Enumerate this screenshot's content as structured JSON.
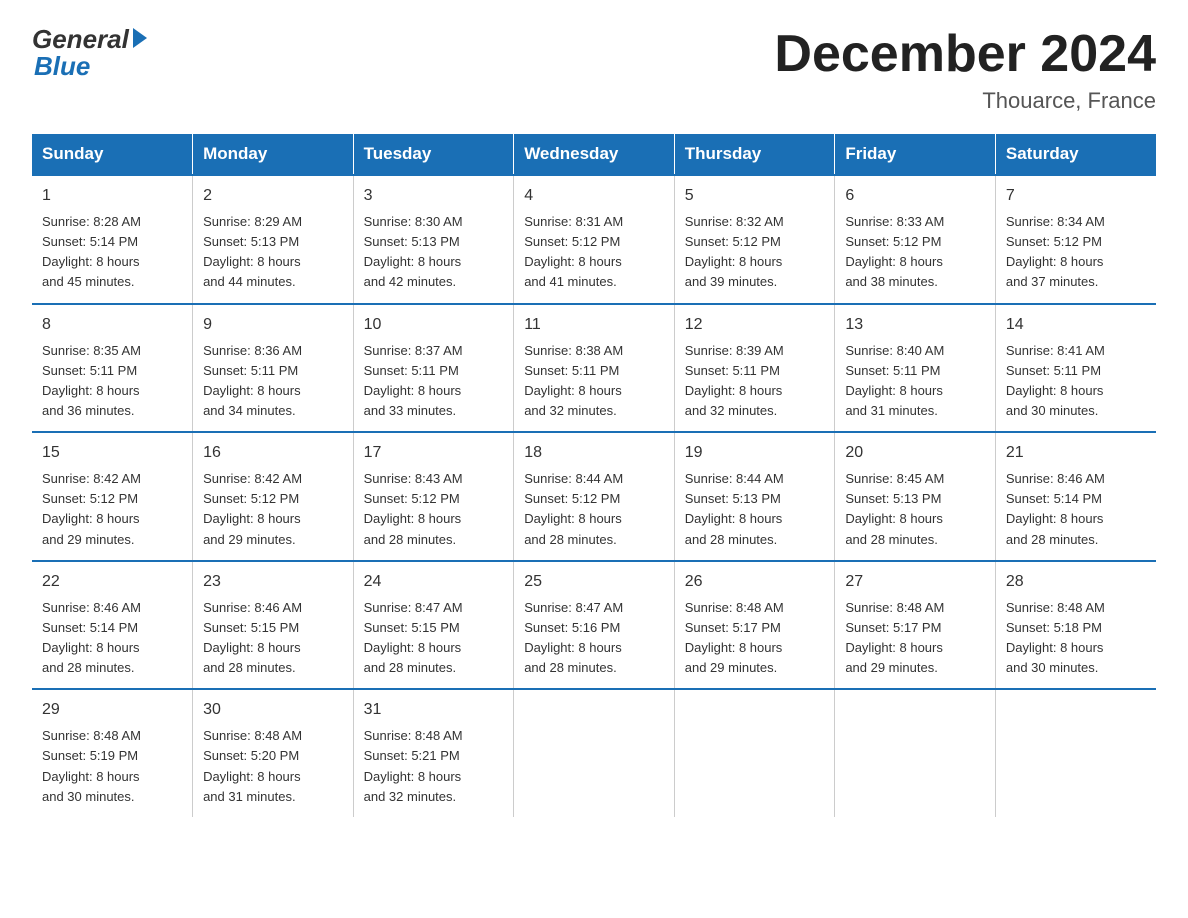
{
  "logo": {
    "general": "General",
    "blue": "Blue"
  },
  "title": "December 2024",
  "location": "Thouarce, France",
  "days_of_week": [
    "Sunday",
    "Monday",
    "Tuesday",
    "Wednesday",
    "Thursday",
    "Friday",
    "Saturday"
  ],
  "weeks": [
    [
      {
        "day": "1",
        "sunrise": "8:28 AM",
        "sunset": "5:14 PM",
        "daylight": "8 hours and 45 minutes."
      },
      {
        "day": "2",
        "sunrise": "8:29 AM",
        "sunset": "5:13 PM",
        "daylight": "8 hours and 44 minutes."
      },
      {
        "day": "3",
        "sunrise": "8:30 AM",
        "sunset": "5:13 PM",
        "daylight": "8 hours and 42 minutes."
      },
      {
        "day": "4",
        "sunrise": "8:31 AM",
        "sunset": "5:12 PM",
        "daylight": "8 hours and 41 minutes."
      },
      {
        "day": "5",
        "sunrise": "8:32 AM",
        "sunset": "5:12 PM",
        "daylight": "8 hours and 39 minutes."
      },
      {
        "day": "6",
        "sunrise": "8:33 AM",
        "sunset": "5:12 PM",
        "daylight": "8 hours and 38 minutes."
      },
      {
        "day": "7",
        "sunrise": "8:34 AM",
        "sunset": "5:12 PM",
        "daylight": "8 hours and 37 minutes."
      }
    ],
    [
      {
        "day": "8",
        "sunrise": "8:35 AM",
        "sunset": "5:11 PM",
        "daylight": "8 hours and 36 minutes."
      },
      {
        "day": "9",
        "sunrise": "8:36 AM",
        "sunset": "5:11 PM",
        "daylight": "8 hours and 34 minutes."
      },
      {
        "day": "10",
        "sunrise": "8:37 AM",
        "sunset": "5:11 PM",
        "daylight": "8 hours and 33 minutes."
      },
      {
        "day": "11",
        "sunrise": "8:38 AM",
        "sunset": "5:11 PM",
        "daylight": "8 hours and 32 minutes."
      },
      {
        "day": "12",
        "sunrise": "8:39 AM",
        "sunset": "5:11 PM",
        "daylight": "8 hours and 32 minutes."
      },
      {
        "day": "13",
        "sunrise": "8:40 AM",
        "sunset": "5:11 PM",
        "daylight": "8 hours and 31 minutes."
      },
      {
        "day": "14",
        "sunrise": "8:41 AM",
        "sunset": "5:11 PM",
        "daylight": "8 hours and 30 minutes."
      }
    ],
    [
      {
        "day": "15",
        "sunrise": "8:42 AM",
        "sunset": "5:12 PM",
        "daylight": "8 hours and 29 minutes."
      },
      {
        "day": "16",
        "sunrise": "8:42 AM",
        "sunset": "5:12 PM",
        "daylight": "8 hours and 29 minutes."
      },
      {
        "day": "17",
        "sunrise": "8:43 AM",
        "sunset": "5:12 PM",
        "daylight": "8 hours and 28 minutes."
      },
      {
        "day": "18",
        "sunrise": "8:44 AM",
        "sunset": "5:12 PM",
        "daylight": "8 hours and 28 minutes."
      },
      {
        "day": "19",
        "sunrise": "8:44 AM",
        "sunset": "5:13 PM",
        "daylight": "8 hours and 28 minutes."
      },
      {
        "day": "20",
        "sunrise": "8:45 AM",
        "sunset": "5:13 PM",
        "daylight": "8 hours and 28 minutes."
      },
      {
        "day": "21",
        "sunrise": "8:46 AM",
        "sunset": "5:14 PM",
        "daylight": "8 hours and 28 minutes."
      }
    ],
    [
      {
        "day": "22",
        "sunrise": "8:46 AM",
        "sunset": "5:14 PM",
        "daylight": "8 hours and 28 minutes."
      },
      {
        "day": "23",
        "sunrise": "8:46 AM",
        "sunset": "5:15 PM",
        "daylight": "8 hours and 28 minutes."
      },
      {
        "day": "24",
        "sunrise": "8:47 AM",
        "sunset": "5:15 PM",
        "daylight": "8 hours and 28 minutes."
      },
      {
        "day": "25",
        "sunrise": "8:47 AM",
        "sunset": "5:16 PM",
        "daylight": "8 hours and 28 minutes."
      },
      {
        "day": "26",
        "sunrise": "8:48 AM",
        "sunset": "5:17 PM",
        "daylight": "8 hours and 29 minutes."
      },
      {
        "day": "27",
        "sunrise": "8:48 AM",
        "sunset": "5:17 PM",
        "daylight": "8 hours and 29 minutes."
      },
      {
        "day": "28",
        "sunrise": "8:48 AM",
        "sunset": "5:18 PM",
        "daylight": "8 hours and 30 minutes."
      }
    ],
    [
      {
        "day": "29",
        "sunrise": "8:48 AM",
        "sunset": "5:19 PM",
        "daylight": "8 hours and 30 minutes."
      },
      {
        "day": "30",
        "sunrise": "8:48 AM",
        "sunset": "5:20 PM",
        "daylight": "8 hours and 31 minutes."
      },
      {
        "day": "31",
        "sunrise": "8:48 AM",
        "sunset": "5:21 PM",
        "daylight": "8 hours and 32 minutes."
      },
      null,
      null,
      null,
      null
    ]
  ],
  "labels": {
    "sunrise": "Sunrise:",
    "sunset": "Sunset:",
    "daylight": "Daylight:"
  }
}
